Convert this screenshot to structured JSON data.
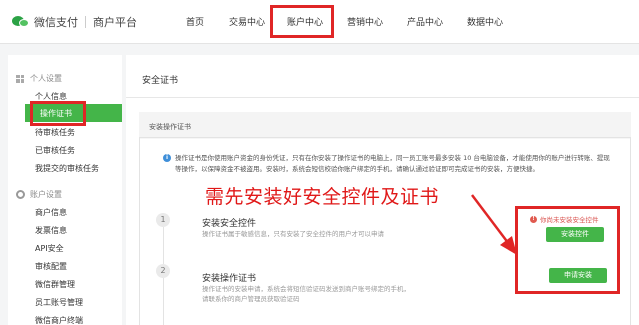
{
  "header": {
    "brand": "微信支付",
    "brand_sub": "商户平台",
    "nav": [
      {
        "label": "首页"
      },
      {
        "label": "交易中心"
      },
      {
        "label": "账户中心"
      },
      {
        "label": "营销中心"
      },
      {
        "label": "产品中心"
      },
      {
        "label": "数据中心"
      }
    ]
  },
  "sidebar": {
    "group1": "个人设置",
    "group1_items": [
      "个人信息",
      "操作证书",
      "待审核任务",
      "已审核任务",
      "我提交的审核任务"
    ],
    "group2": "账户设置",
    "group2_items": [
      "商户信息",
      "发票信息",
      "API安全",
      "审核配置",
      "微信群管理",
      "员工账号管理",
      "微信商户终端"
    ]
  },
  "main": {
    "title": "安全证书",
    "panel_title": "安装操作证书",
    "info": "操作证书是你使用账户资金的身份凭证，只有在你安装了操作证书的电脑上，同一员工账号最多安装 10 台电脑设备，才能使用你的账户进行转账、提现等操作，以保障资金不被盗用。安装时，系统会短信校验你账户绑定的手机，请确认通过验证即可完成证书的安装，方便快捷。",
    "annotation": "需先安装好安全控件及证书",
    "steps": [
      {
        "num": "1",
        "title": "安装安全控件",
        "desc": "操作证书属于敏感信息，只有安装了安全控件的用户才可以申请"
      },
      {
        "num": "2",
        "title": "安装操作证书",
        "desc": "操作证书的安装申请，系统会将短信验证码发送到商户账号绑定的手机，",
        "desc2": "请联系你的商户管理员获取验证码"
      }
    ],
    "warning": "你尚未安装安全控件",
    "install_button": "安装控件",
    "apply_button": "申请安装"
  },
  "colors": {
    "brand_green": "#44b549",
    "highlight_red": "#e02626",
    "info_blue": "#3f8fd9"
  }
}
